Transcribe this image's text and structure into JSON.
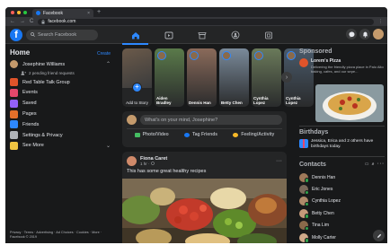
{
  "browser": {
    "tab_title": "Facebook",
    "tab_close": "×",
    "new_tab": "+",
    "url": "facebook.com",
    "back": "←",
    "forward": "→",
    "reload": "C"
  },
  "header": {
    "logo": "f",
    "search_placeholder": "Search Facebook",
    "nav": [
      "home-icon",
      "watch-icon",
      "marketplace-icon",
      "groups-icon",
      "gaming-icon"
    ],
    "actions": [
      "messenger-icon",
      "notifications-icon",
      "profile-avatar"
    ]
  },
  "sidebar": {
    "title": "Home",
    "edit": "Create",
    "profile_name": "Josephine Williams",
    "profile_sub": "2 pending friend requests",
    "items": [
      {
        "label": "Red Table Talk Group",
        "icon": "group-icon",
        "color": "#e0542a"
      },
      {
        "label": "Events",
        "icon": "events-icon",
        "color": "#e4486b"
      },
      {
        "label": "Saved",
        "icon": "saved-icon",
        "color": "#9360f7"
      },
      {
        "label": "Pages",
        "icon": "pages-icon",
        "color": "#e4702a"
      },
      {
        "label": "Friends",
        "icon": "friends-icon",
        "color": "#2d88ff"
      },
      {
        "label": "Settings & Privacy",
        "icon": "settings-icon",
        "color": "#b0b3b8"
      },
      {
        "label": "See More",
        "icon": "see-more-icon",
        "color": "#f0c542"
      }
    ],
    "footer": "Privacy · Terms · Advertising · Ad Choices · Cookies · More · Facebook © 2019"
  },
  "stories": [
    {
      "name": "Add to Story",
      "type": "create"
    },
    {
      "name": "Aiden Bradley",
      "color": "#5a7a4a"
    },
    {
      "name": "Dennis Han",
      "color": "#8a6a5a"
    },
    {
      "name": "Betty Chen",
      "color": "#7a8a9a"
    },
    {
      "name": "Cynthia Lopez",
      "color": "#6a7a5a"
    },
    {
      "name": "Cynthia Lopez",
      "color": "#4a5a6a"
    }
  ],
  "composer": {
    "placeholder": "What's on your mind, Josephine?",
    "actions": [
      {
        "label": "Photo/Video",
        "color": "#45bd62"
      },
      {
        "label": "Tag Friends",
        "color": "#1877f2"
      },
      {
        "label": "Feeling/Activity",
        "color": "#f7b928"
      }
    ]
  },
  "post": {
    "author": "Fiona Caret",
    "time": "1 hr · ",
    "text": "This has some great healthy recipes",
    "more": "···"
  },
  "sponsored": {
    "title": "Sponsored",
    "ad_name": "Lorem's Pizza",
    "ad_desc": "Delivering the friendly pizza place in Palo Alto baking, cafes, and our sepe..."
  },
  "birthdays": {
    "title": "Birthdays",
    "text": "Jessica, Erica and 2 others have birthdays today."
  },
  "contacts": {
    "title": "Contacts",
    "icons": "▭ ⌕ ···",
    "list": [
      {
        "name": "Dennis Han",
        "color": "#a07a5a"
      },
      {
        "name": "Eric Jones",
        "color": "#7a6a5a"
      },
      {
        "name": "Cynthia Lopez",
        "color": "#b08a6a"
      },
      {
        "name": "Betty Chen",
        "color": "#c49a7a"
      },
      {
        "name": "Tina Lim",
        "color": "#8a6a4a"
      },
      {
        "name": "Molly Carter",
        "color": "#d0aa8a"
      }
    ]
  }
}
